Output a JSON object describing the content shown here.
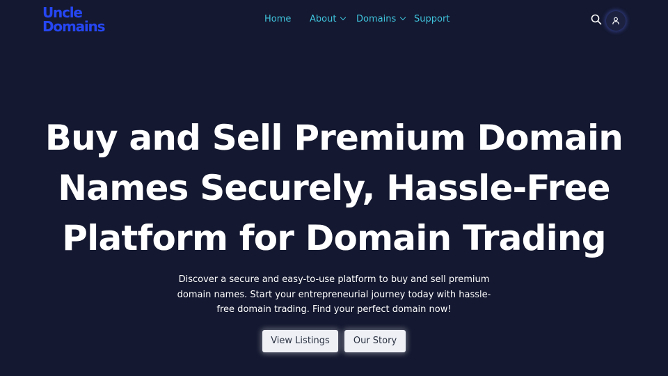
{
  "logo": {
    "line1": "Uncle",
    "line2": "Domains"
  },
  "nav": {
    "items": [
      {
        "label": "Home"
      },
      {
        "label": "About"
      },
      {
        "label": "Domains"
      },
      {
        "label": "Support"
      }
    ]
  },
  "icons": {
    "search": "search-icon",
    "user": "user-icon",
    "dropdown": "chevron-down-icon"
  },
  "hero": {
    "title": "Buy and Sell Premium Domain Names Securely, Hassle-Free Platform for Domain Trading",
    "subtitle": "Discover a secure and easy-to-use platform to buy and sell premium domain names. Start your entrepreneurial journey today with hassle-free domain trading. Find your perfect domain now!",
    "buttons": [
      {
        "label": "View Listings"
      },
      {
        "label": "Our Story"
      }
    ]
  },
  "colors": {
    "background": "#141830",
    "brand": "#2546f2",
    "nav_link": "#3fc3dc",
    "button_bg": "#eef0f6"
  }
}
